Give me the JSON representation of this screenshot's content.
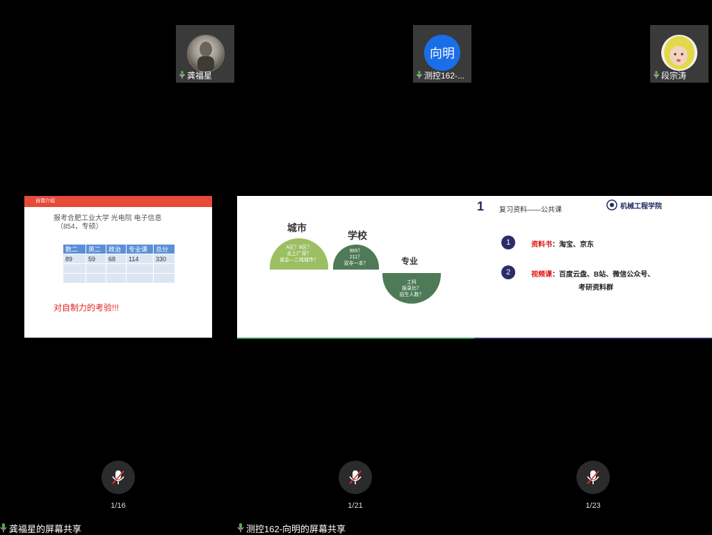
{
  "panels": [
    {
      "participant": "龚福星",
      "page": "1/16",
      "share_label": "龚福星的屏幕共享",
      "slide": {
        "header": "自我介绍",
        "line1": "报考合肥工业大学  光电院  电子信息",
        "line2": "（854，专硕）",
        "table_headers": [
          "数二",
          "英二",
          "政治",
          "专业课",
          "总分"
        ],
        "table_rows": [
          [
            "89",
            "59",
            "68",
            "114",
            "330"
          ],
          [
            "",
            "",
            "",
            "",
            ""
          ],
          [
            "",
            "",
            "",
            "",
            ""
          ]
        ],
        "footer": "对自制力的考验!!!"
      }
    },
    {
      "participant": "测控162-...",
      "avatar_text": "向明",
      "page": "1/21",
      "share_label": "测控162-向明的屏幕共享",
      "slide": {
        "city": {
          "title": "城市",
          "lines": [
            "A区？B区？",
            "北上广深？",
            "省会—二线城市？"
          ]
        },
        "school": {
          "title": "学校",
          "lines": [
            "985？",
            "211？",
            "双非一本？"
          ]
        },
        "major": {
          "title": "专业",
          "lines": [
            "工科",
            "报录比？",
            "招生人数？"
          ]
        }
      }
    },
    {
      "participant": "段宗涛",
      "page": "1/23",
      "share_label": "",
      "slide": {
        "number": "1",
        "title": "复习资料——公共课",
        "logo_text": "机械工程学院",
        "item1_no": "1",
        "item1_label": "资料书",
        "item1_text": "：淘宝、京东",
        "item2_no": "2",
        "item2_label": "视频课",
        "item2_text": "：百度云盘、B站、微信公众号、",
        "item2_text2": "考研资料群"
      }
    }
  ],
  "colors": {
    "slide1_header": "#e64a3b",
    "semi_light_green": "#9bbf62",
    "semi_dark_green": "#4e7a58",
    "mic_green": "#4caf50",
    "avatar_blue": "#1a6ee8",
    "muted_red": "#e53935"
  },
  "icons": [
    "mic-icon",
    "muted-mic-icon",
    "avatar-photo"
  ]
}
